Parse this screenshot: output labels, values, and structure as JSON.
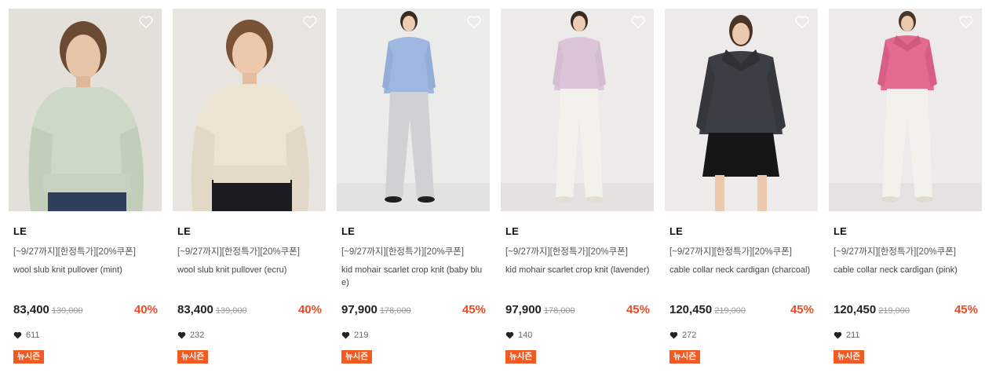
{
  "colors": {
    "accent": "#ef4a24",
    "badge_bg": "#f15a22"
  },
  "icons": {
    "wishlist": "heart-outline-icon",
    "likes": "heart-filled-icon"
  },
  "products": [
    {
      "brand": "LE",
      "promo": "[~9/27까지][한정특가][20%쿠폰]",
      "name": "wool slub knit pullover (mint)",
      "price": "83,400",
      "original_price": "139,000",
      "discount": "40%",
      "likes": "611",
      "badge": "뉴시즌"
    },
    {
      "brand": "LE",
      "promo": "[~9/27까지][한정특가][20%쿠폰]",
      "name": "wool slub knit pullover (ecru)",
      "price": "83,400",
      "original_price": "139,000",
      "discount": "40%",
      "likes": "232",
      "badge": "뉴시즌"
    },
    {
      "brand": "LE",
      "promo": "[~9/27까지][한정특가][20%쿠폰]",
      "name": "kid mohair scarlet crop knit (baby blue)",
      "price": "97,900",
      "original_price": "178,000",
      "discount": "45%",
      "likes": "219",
      "badge": "뉴시즌"
    },
    {
      "brand": "LE",
      "promo": "[~9/27까지][한정특가][20%쿠폰]",
      "name": "kid mohair scarlet crop knit (lavender)",
      "price": "97,900",
      "original_price": "178,000",
      "discount": "45%",
      "likes": "140",
      "badge": "뉴시즌"
    },
    {
      "brand": "LE",
      "promo": "[~9/27까지][한정특가][20%쿠폰]",
      "name": "cable collar neck cardigan (charcoal)",
      "price": "120,450",
      "original_price": "219,000",
      "discount": "45%",
      "likes": "272",
      "badge": "뉴시즌"
    },
    {
      "brand": "LE",
      "promo": "[~9/27까지][한정특가][20%쿠폰]",
      "name": "cable collar neck cardigan (pink)",
      "price": "120,450",
      "original_price": "219,000",
      "discount": "45%",
      "likes": "211",
      "badge": "뉴시즌"
    }
  ]
}
